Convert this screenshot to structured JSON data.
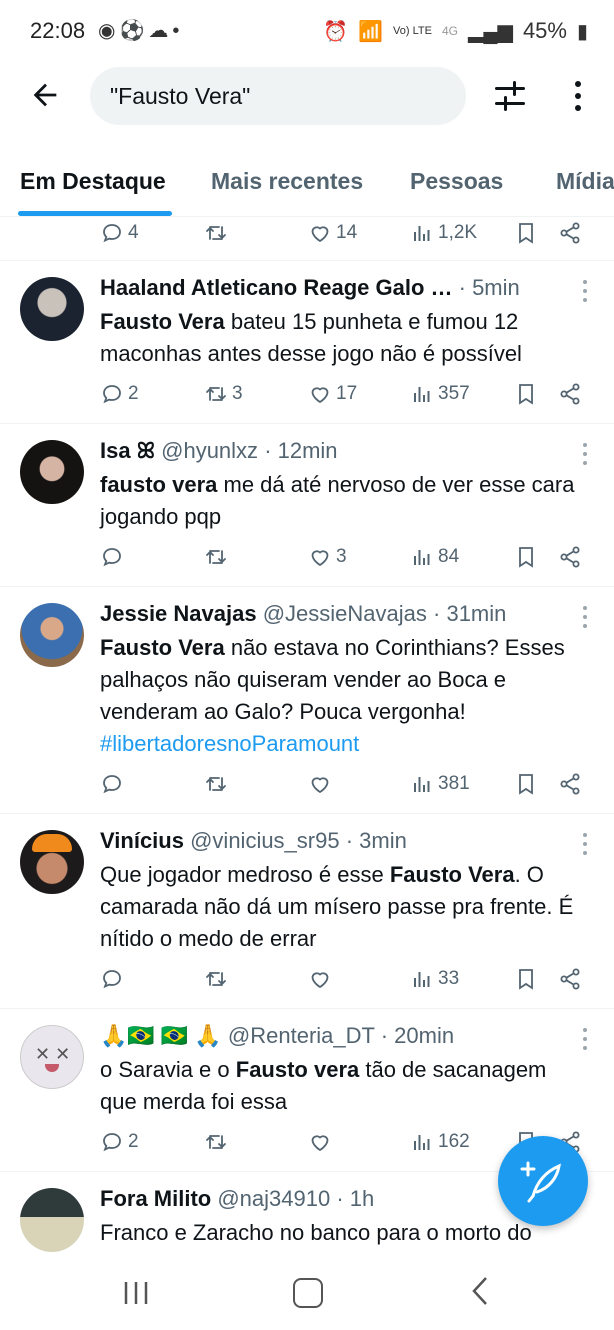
{
  "status": {
    "time": "22:08",
    "battery": "45%",
    "network": "4G",
    "volte": "Vo) LTE"
  },
  "search": {
    "query": "\"Fausto Vera\""
  },
  "tabs": [
    {
      "label": "Em Destaque",
      "active": true
    },
    {
      "label": "Mais recentes",
      "active": false
    },
    {
      "label": "Pessoas",
      "active": false
    },
    {
      "label": "Mídia",
      "active": false
    }
  ],
  "top_actions": {
    "replies": "4",
    "retweets": "",
    "likes": "14",
    "views": "1,2K"
  },
  "tweets": [
    {
      "name": "Haaland Atleticano Reage Galo …",
      "handle": "",
      "time": "· 5min",
      "text_parts": [
        [
          "b",
          "Fausto Vera"
        ],
        [
          "t",
          " bateu 15 punheta e fumou 12 maconhas antes desse jogo não é possível"
        ]
      ],
      "replies": "2",
      "retweets": "3",
      "likes": "17",
      "views": "357"
    },
    {
      "name": "Isa ꕤ",
      "handle": "@hyunlxz",
      "time": "· 12min",
      "text_parts": [
        [
          "b",
          "fausto vera"
        ],
        [
          "t",
          " me dá até nervoso de ver esse cara jogando pqp"
        ]
      ],
      "replies": "",
      "retweets": "",
      "likes": "3",
      "views": "84"
    },
    {
      "name": "Jessie Navajas",
      "handle": "@JessieNavajas",
      "time": "· 31min",
      "text_parts": [
        [
          "b",
          "Fausto Vera"
        ],
        [
          "t",
          " não estava no Corinthians? Esses palhaços não quiseram vender ao Boca e venderam ao Galo? Pouca vergonha! "
        ],
        [
          "h",
          "#libertadoresnoParamount"
        ]
      ],
      "replies": "",
      "retweets": "",
      "likes": "",
      "views": "381"
    },
    {
      "name": "Vinícius",
      "handle": "@vinicius_sr95",
      "time": "· 3min",
      "text_parts": [
        [
          "t",
          "Que jogador medroso é esse "
        ],
        [
          "b",
          "Fausto Vera"
        ],
        [
          "t",
          ". O camarada não dá um mísero passe pra frente. É nítido o medo de errar"
        ]
      ],
      "replies": "",
      "retweets": "",
      "likes": "",
      "views": "33"
    },
    {
      "name": "🙏🇧🇷 🇧🇷 🙏",
      "handle": "@Renteria_DT",
      "time": "· 20min",
      "text_parts": [
        [
          "t",
          "o Saravia e  o "
        ],
        [
          "b",
          "Fausto vera"
        ],
        [
          "t",
          " tão de sacanagem que merda foi essa"
        ]
      ],
      "replies": "2",
      "retweets": "",
      "likes": "",
      "views": "162"
    },
    {
      "name": "Fora Milito",
      "handle": "@naj34910",
      "time": "· 1h",
      "text_parts": [
        [
          "t",
          "Franco e Zaracho no banco para o morto do"
        ]
      ],
      "replies": "",
      "retweets": "",
      "likes": "",
      "views": ""
    }
  ],
  "colors": {
    "accent": "#1d9bf0",
    "muted": "#536471",
    "text": "#0f1419"
  },
  "icons": [
    "back-arrow-icon",
    "filter-icon",
    "more-vertical-icon",
    "reply-icon",
    "retweet-icon",
    "like-icon",
    "views-icon",
    "bookmark-icon",
    "share-icon",
    "compose-icon"
  ]
}
